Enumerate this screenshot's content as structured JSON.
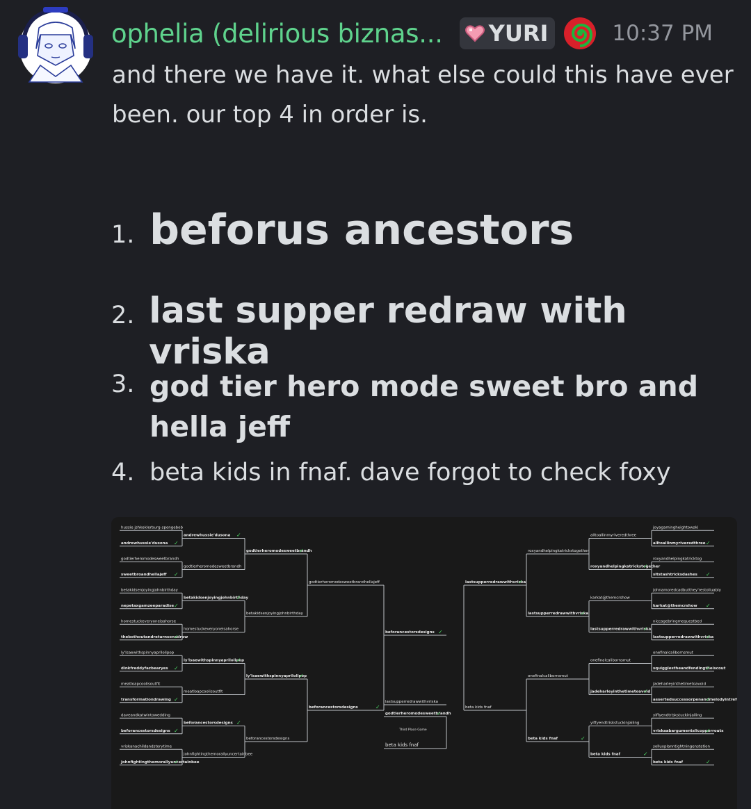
{
  "message": {
    "username": "ophelia (delirious biznas...",
    "role_tag": "YURI",
    "timestamp": "10:37 PM",
    "text": "and there we have it. what else could this have ever been. our top 4 in order is.",
    "list": [
      {
        "num": "1.",
        "text": "beforus ancestors",
        "style": "heading-1"
      },
      {
        "num": "2.",
        "text": "last supper redraw with vriska",
        "style": "heading-2"
      },
      {
        "num": "3.",
        "text": "god tier hero mode sweet bro and hella jeff",
        "style": "heading-3"
      },
      {
        "num": "4.",
        "text": "beta kids in fnaf. dave forgot to check foxy",
        "style": "normal"
      }
    ]
  },
  "colors": {
    "background": "#1e1f24",
    "username": "#5fd38d",
    "text": "#dbdee1",
    "timestamp": "#94979e",
    "tag_bg": "#34363d"
  },
  "icons": {
    "role": "pink-heart-icon",
    "badge": "spiral-icon"
  },
  "bracket": {
    "left_r1": [
      "hussie jshkeklerburg-spongebob",
      "andrewhussie'dusona",
      "godtierheromodesweetbrandh",
      "sweetbroandhellajeff",
      "betakidsenjoyingjohnbirthday",
      "nepetaxgamzeeparadise",
      "homestuckeveryoneisahorse",
      "thebothoutandreturnsonadraw",
      "ly'lsaewithspinnyaprilolipop",
      "dinkfreddyfazbearyes",
      "meatloapcoolisoutfit",
      "transformationdrawing",
      "daveandkatwintowedding",
      "beforancestorsdesigns",
      "vriskanachildandstorytime",
      "johnfightingthemorallyuncertainbee"
    ],
    "left_r2": [
      "andrewhussie'dusona",
      "godtierheromodesweetbrandh",
      "betakidsenjoyingjohnbirthday",
      "homestuckeveryoneisahorse",
      "ly'lsaewithspinnyaprilolipop",
      "meatloapcoolisoutfit",
      "beforancestorsdesigns",
      "johnfightingthemorallyuncertainbee"
    ],
    "left_r3": [
      "godtierheromodesweetbrandh",
      "betakidsenjoyingjohnbirthday",
      "ly'lsaewithspinnyaprilolipop",
      "beforancestorsdesigns"
    ],
    "left_r4": [
      "godtierheromodesweetbrandhellajeff",
      "beforancestorsdesigns"
    ],
    "final": [
      "beforancestorsdesigns",
      "lastsupperredrawwithvriska"
    ],
    "third_place_label": "Third Place Game",
    "third_place": [
      "godtierheromodesweetbrandh",
      "beta kids fnaf"
    ],
    "right_r4": [
      "lastsupperredrawwithvriska",
      "beta kids fnaf"
    ],
    "right_r3": [
      "roxyandhelpingkatrickstogether",
      "lastsupperredrawwithvriska",
      "onefinalcalibornsmut",
      "beta kids fnaf"
    ],
    "right_r2": [
      "alltoallinmyriveredthree",
      "roxyandhelpingkatrickstogether",
      "karkat@themcrshow",
      "lastsupperredrawwithvriska",
      "onefinalcalibornsmut",
      "jadeharleyinthetimetoavoid",
      "yiffyendtriskstuckinjailing",
      "beta kids fnaf"
    ],
    "right_r1": [
      "joyagamingheightowski",
      "alltoallinmyriveredthree",
      "roxyandhelpingkatricktog",
      "sitstashtricksdashes",
      "johnamoredcadbutthey'restolluably",
      "karkat@themcrshow",
      "niccagebringmequestbed",
      "lastsupperredrawwithvriska",
      "onefinalcalibornsmut",
      "squigglestheandfendingtheiscout",
      "jadeharleyinthetimetoavoid",
      "assertedsuccessorpenandmelodyintrefc",
      "yiffyendtriskstuckinjailing",
      "vriskaabargumentslicopperrouts",
      "solluxplanntightningenstation",
      "beta kids fnaf"
    ]
  }
}
